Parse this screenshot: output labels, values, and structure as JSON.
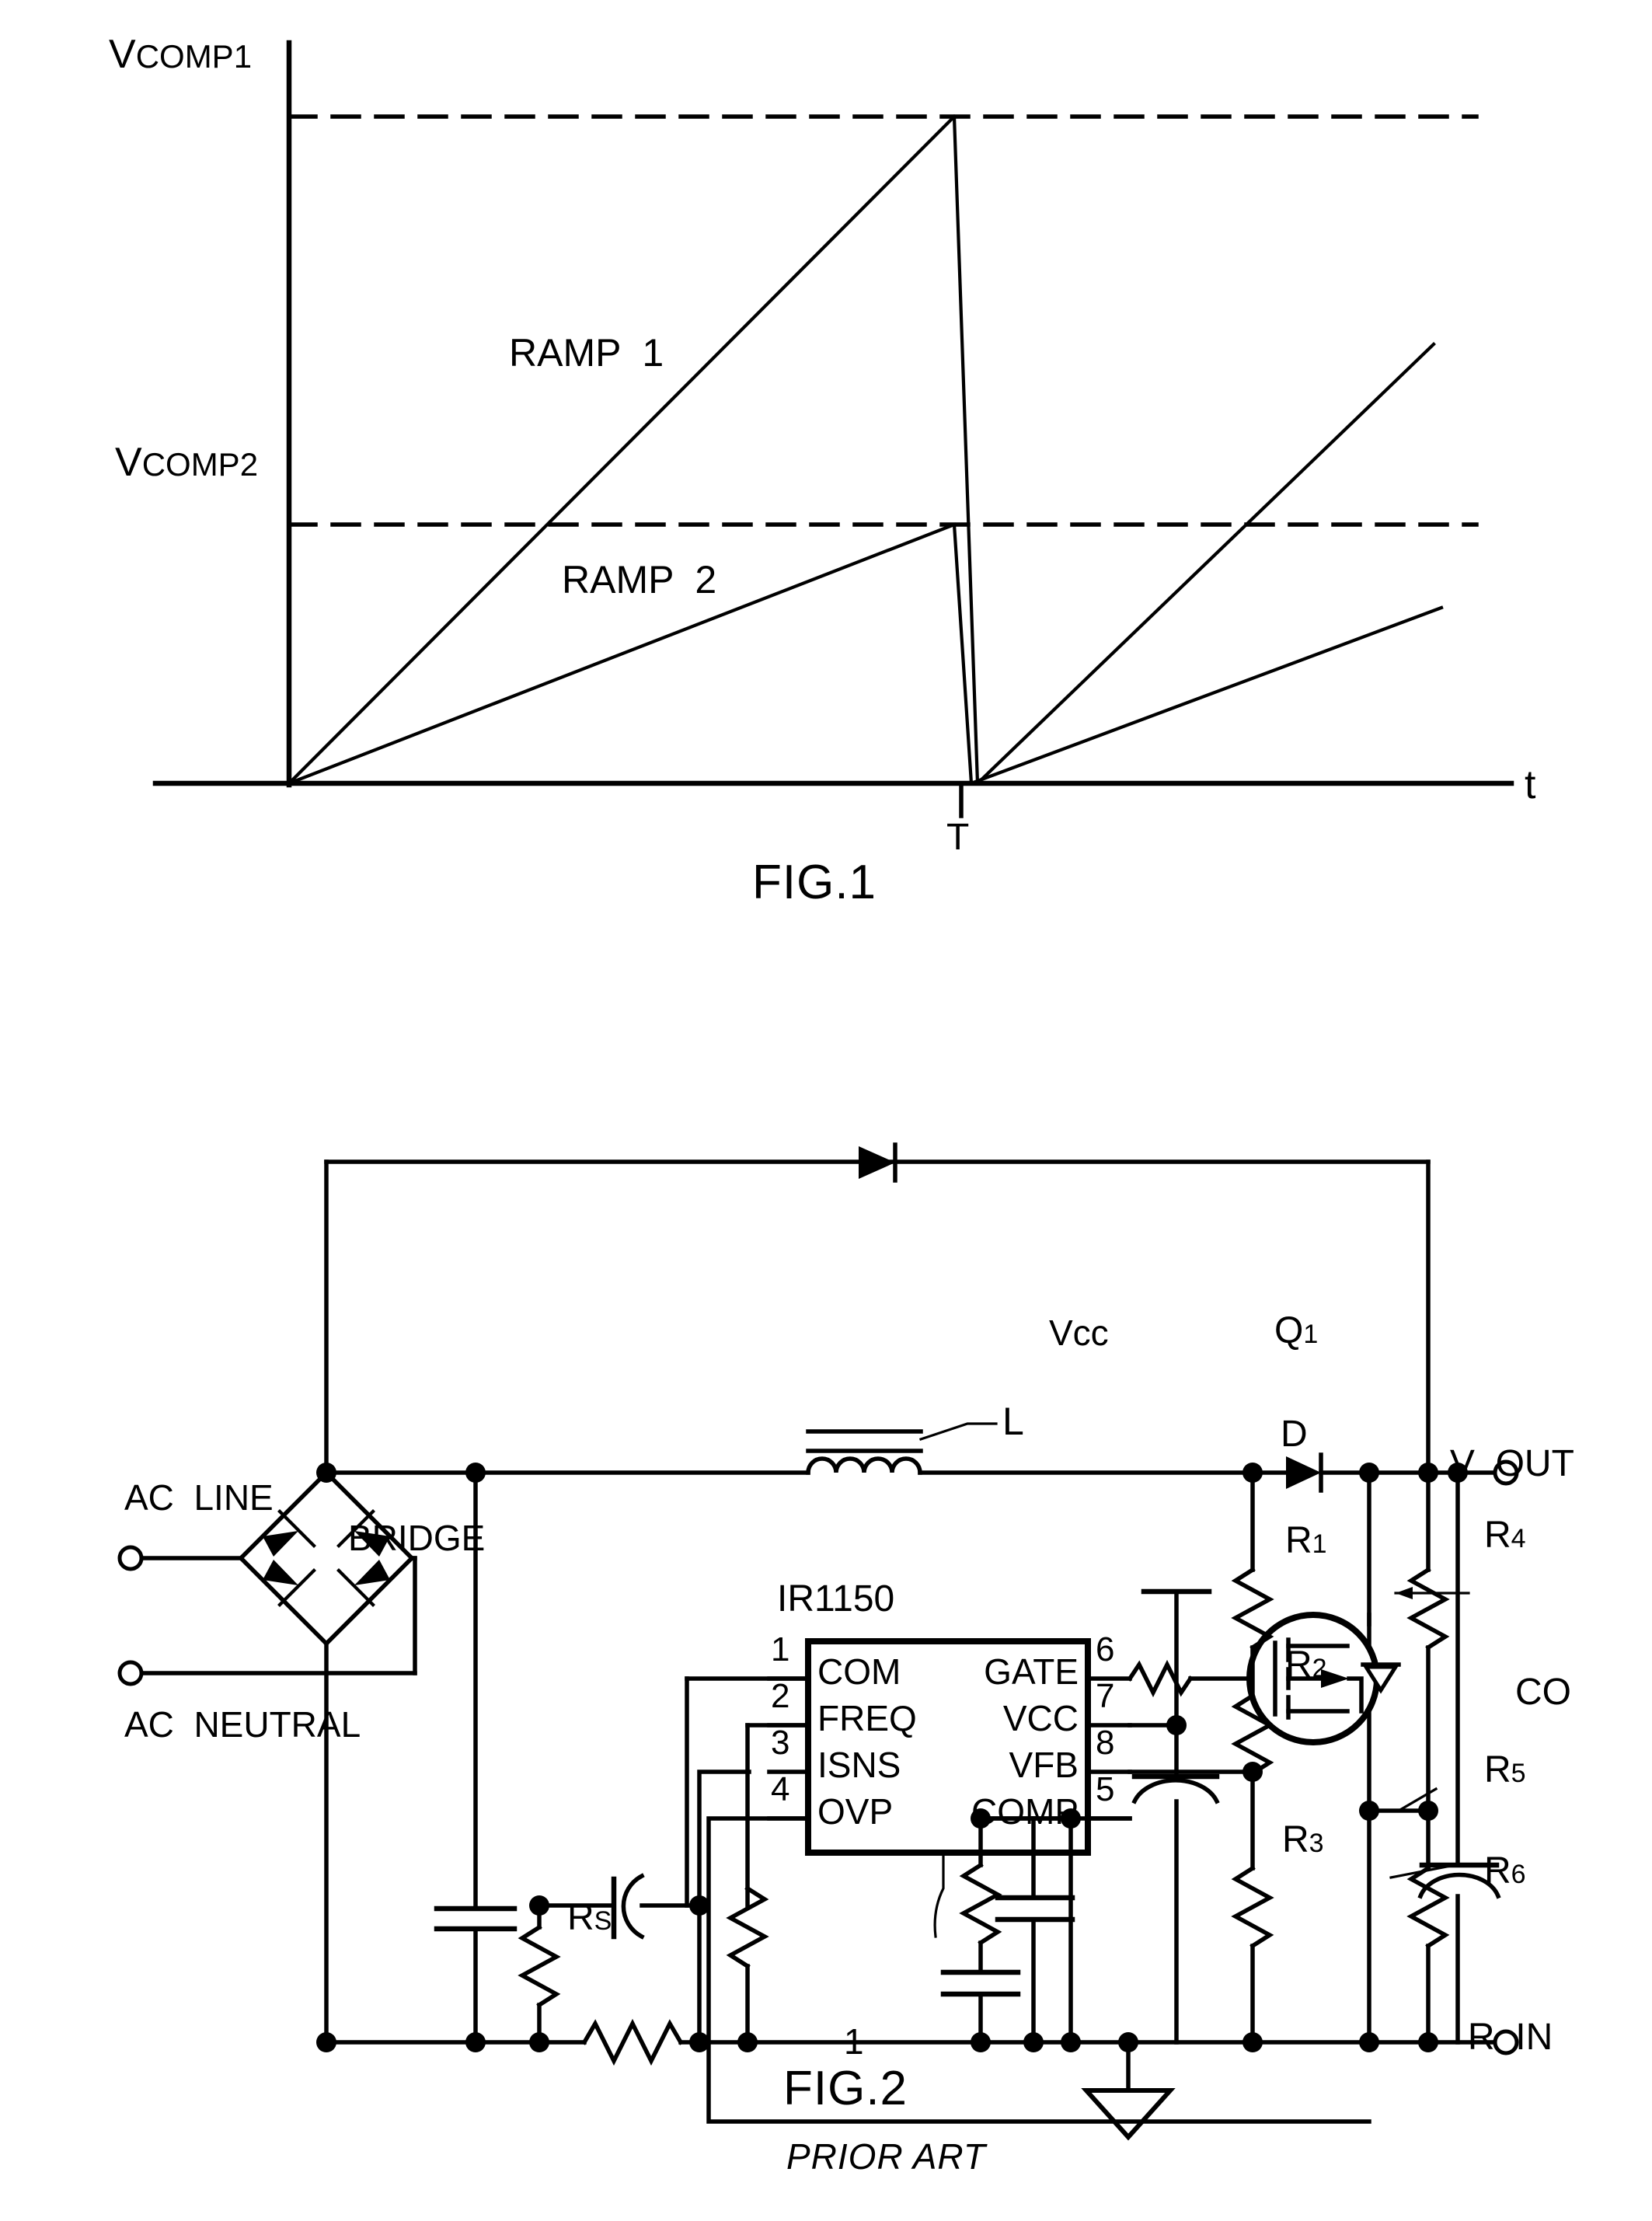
{
  "figure1": {
    "caption": "FIG.1",
    "y_labels": [
      {
        "main": "V",
        "sub": "COMP1"
      },
      {
        "main": "V",
        "sub": "COMP2"
      }
    ],
    "x_axis_label": "t",
    "period_label": "T",
    "curve_labels": [
      "RAMP  1",
      "RAMP  2"
    ]
  },
  "chart_data": {
    "type": "line",
    "title": "FIG.1",
    "xlabel": "t",
    "ylabel": "",
    "xlim": [
      0,
      1
    ],
    "ylim": [
      0,
      1.1
    ],
    "grid": false,
    "legend": "inline-annotation",
    "annotations": [
      "RAMP  1",
      "RAMP  2",
      "V COMP1",
      "V COMP2",
      "T",
      "t"
    ],
    "threshold_lines": [
      {
        "name": "V COMP1",
        "value": 1.0,
        "style": "dashed"
      },
      {
        "name": "V COMP2",
        "value": 0.42,
        "style": "dashed"
      }
    ],
    "x_ticks": [
      {
        "label": "T",
        "value": 0.56
      }
    ],
    "series": [
      {
        "name": "RAMP  1",
        "comment": "sawtooth reaching V COMP1 at t=T then reset",
        "x": [
          0.0,
          0.56,
          0.565,
          1.0
        ],
        "y": [
          0.0,
          1.0,
          0.0,
          0.78
        ]
      },
      {
        "name": "RAMP  2",
        "comment": "slower sawtooth reaching V COMP2 at t=T then reset",
        "x": [
          0.0,
          0.555,
          0.565,
          1.0
        ],
        "y": [
          0.0,
          0.42,
          0.0,
          0.33
        ]
      }
    ]
  },
  "figure2": {
    "caption": "FIG.2",
    "subcaption": "PRIOR ART",
    "chip": {
      "part_number": "IR1150",
      "reference_numeral": "1",
      "pins_left": [
        {
          "number": "1",
          "name": "COM"
        },
        {
          "number": "2",
          "name": "FREQ"
        },
        {
          "number": "3",
          "name": "ISNS"
        },
        {
          "number": "4",
          "name": "OVP"
        }
      ],
      "pins_right": [
        {
          "number": "6",
          "name": "GATE"
        },
        {
          "number": "7",
          "name": "VCC"
        },
        {
          "number": "8",
          "name": "VFB"
        },
        {
          "number": "5",
          "name": "COMP"
        }
      ]
    },
    "terminals": [
      {
        "id": "ac-line",
        "label": "AC  LINE"
      },
      {
        "id": "ac-neutral",
        "label": "AC  NEUTRAL"
      },
      {
        "id": "v-out",
        "label": "V  OUT"
      },
      {
        "id": "r-in",
        "label": "R  IN"
      }
    ],
    "components": [
      {
        "id": "bridge",
        "label": "BRIDGE"
      },
      {
        "id": "inductor",
        "label": "L"
      },
      {
        "id": "diode-d",
        "label": "D"
      },
      {
        "id": "mosfet",
        "label": "Q",
        "sub": "1"
      },
      {
        "id": "vcc-rail",
        "label": "Vcc"
      },
      {
        "id": "resistor-r1",
        "label": "R",
        "sub": "1"
      },
      {
        "id": "resistor-r2",
        "label": "R",
        "sub": "2"
      },
      {
        "id": "resistor-r3",
        "label": "R",
        "sub": "3"
      },
      {
        "id": "resistor-r4",
        "label": "R",
        "sub": "4"
      },
      {
        "id": "resistor-r5",
        "label": "R",
        "sub": "5"
      },
      {
        "id": "resistor-r6",
        "label": "R",
        "sub": "6"
      },
      {
        "id": "resistor-rs",
        "label": "R",
        "sub": "S"
      },
      {
        "id": "cap-co",
        "label": "CO"
      }
    ]
  }
}
